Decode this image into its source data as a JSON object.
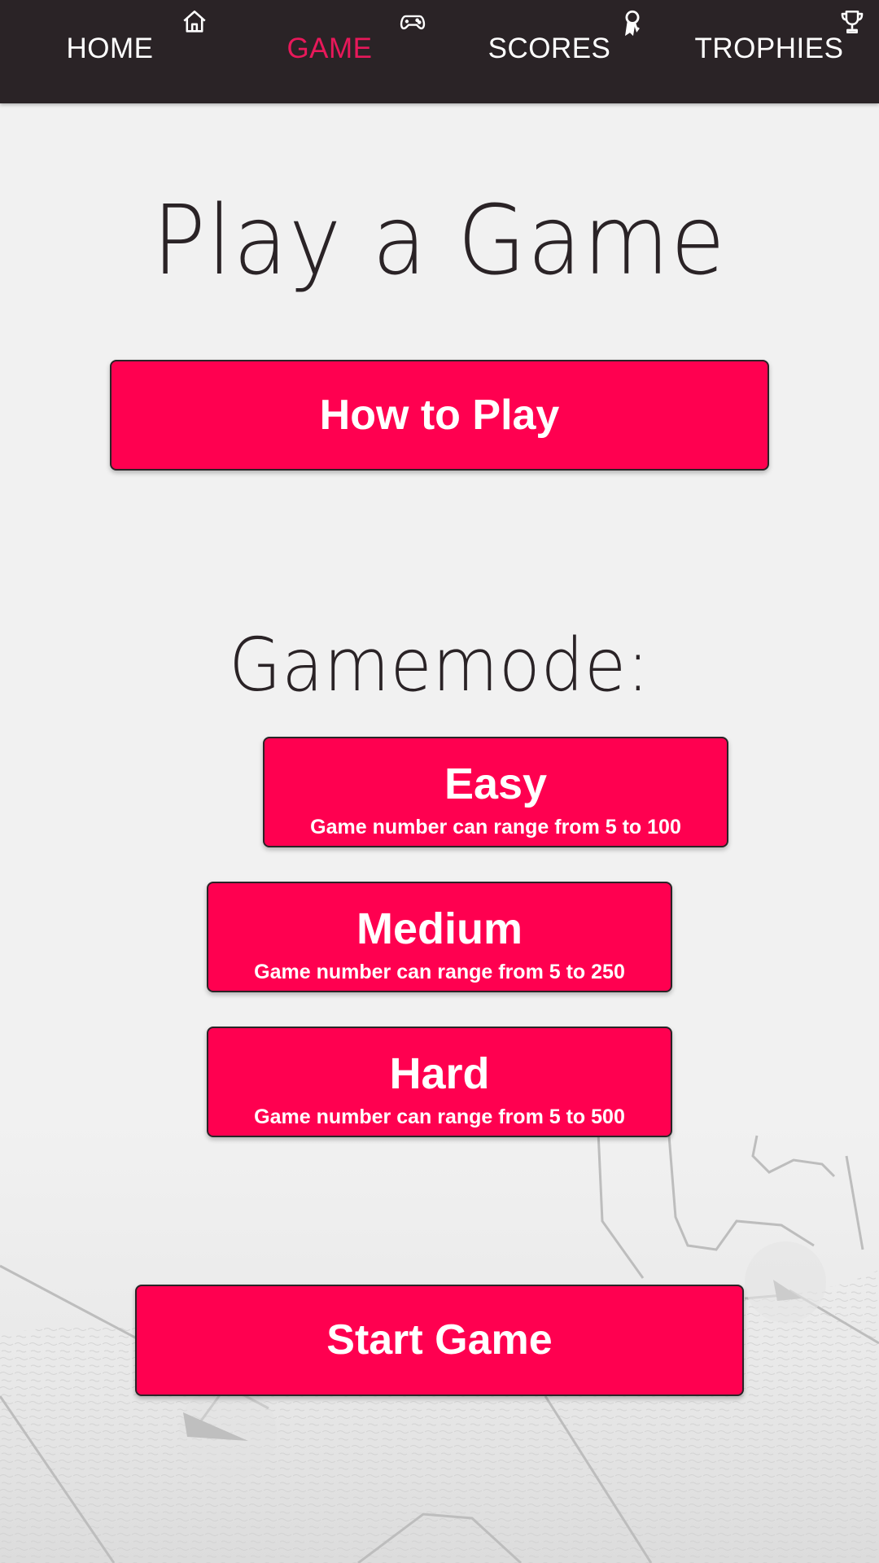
{
  "nav": {
    "items": [
      {
        "label": "HOME",
        "icon": "home-icon",
        "active": false
      },
      {
        "label": "GAME",
        "icon": "gamepad-icon",
        "active": true
      },
      {
        "label": "SCORES",
        "icon": "award-ribbon-icon",
        "active": false
      },
      {
        "label": "TROPHIES",
        "icon": "trophy-icon",
        "active": false
      }
    ],
    "background_color": "#2a2326",
    "active_color": "#e8185a",
    "text_color": "#ffffff"
  },
  "page": {
    "title": "Play a Game",
    "how_to_play_label": "How to Play",
    "gamemode_heading": "Gamemode:",
    "modes": [
      {
        "name": "Easy",
        "description": "Game number can range from 5 to 100"
      },
      {
        "name": "Medium",
        "description": "Game number can range from 5 to 250"
      },
      {
        "name": "Hard",
        "description": "Game number can range from 5 to 500"
      }
    ],
    "start_label": "Start Game"
  },
  "colors": {
    "accent": "#ff0050",
    "background": "#f1f1f1",
    "text_dark": "#2a2326"
  }
}
